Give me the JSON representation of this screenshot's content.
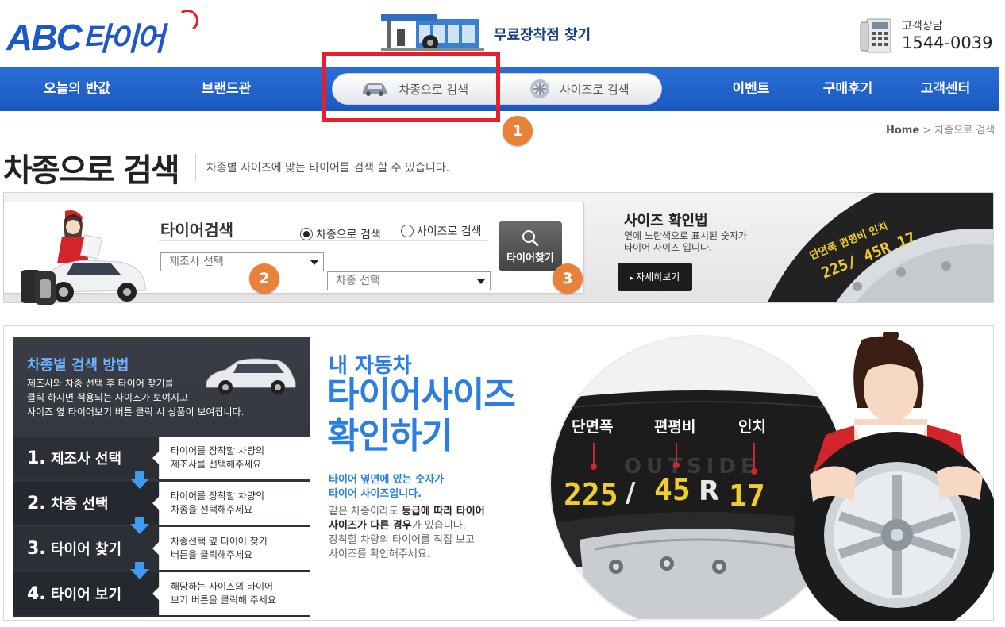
{
  "header": {
    "logo_latin": "ABC",
    "logo_korean": "타이어",
    "store_link": "무료장착점 찾기",
    "cs_label": "고객상담",
    "cs_number": "1544-0039"
  },
  "nav": {
    "items": [
      "오늘의 반값",
      "브랜드관",
      "이벤트",
      "구매후기",
      "고객센터"
    ],
    "search_tabs": [
      "차종으로 검색",
      "사이즈로 검색"
    ]
  },
  "markers": [
    "1",
    "2",
    "3"
  ],
  "breadcrumb": {
    "home": "Home",
    "separator": ">",
    "current": "차종으로 검색"
  },
  "page": {
    "title": "차종으로 검색",
    "description": "차종별 사이즈에 맞는 타이어를 검색 할 수 있습니다."
  },
  "search": {
    "title": "타이어검색",
    "radio_options": [
      "차종으로 검색",
      "사이즈로 검색"
    ],
    "selected_radio": "차종으로 검색",
    "manufacturer_select": "제조사 선택",
    "model_select": "차종 선택",
    "find_button": "타이어찾기"
  },
  "size_check": {
    "title": "사이즈 확인법",
    "desc_line1": "옆에 노란색으로 표시된 숫자가",
    "desc_line2": "타이어 사이즈 입니다.",
    "detail_button": "자세히보기",
    "sidewall_text": "단면폭 편평비 인치",
    "sidewall_size": "225/ 45R 17"
  },
  "guide": {
    "title": "차종별 검색 방법",
    "desc_line1": "제조사와 차종 선택 후 타이어 찾기를",
    "desc_line2": "클릭 하시면 적용되는 사이즈가 보여지고",
    "desc_line3": "사이즈 옆 타이어보기 버튼 클릭 시 상품이 보여집니다.",
    "steps": [
      {
        "num": "1.",
        "name": "제조사 선택",
        "desc1": "타이어를 장착할 차량의",
        "desc2": "제조사를 선택해주세요"
      },
      {
        "num": "2.",
        "name": "차종 선택",
        "desc1": "타이어를 장착할 차량의",
        "desc2": "차종을 선택해주세요"
      },
      {
        "num": "3.",
        "name": "타이어 찾기",
        "desc1": "차종선택 옆 타이어 찾기",
        "desc2": "버튼을 클릭해주세요"
      },
      {
        "num": "4.",
        "name": "타이어 보기",
        "desc1": "해당하는 사이즈의 타이어",
        "desc2": "보기 버튼을 클릭해 주세요"
      }
    ]
  },
  "tire_check": {
    "kicker": "내 자동차",
    "head_line1": "타이어사이즈",
    "head_line2": "확인하기",
    "highlight_line1": "타이어 옆면에 있는 숫자가",
    "highlight_line2": "타이어 사이즈입니다.",
    "body_line1_pre": "같은 차종이라도 ",
    "body_line1_bold": "등급에 따라 타이어",
    "body_line2_bold": "사이즈가 다른 경우",
    "body_line2_post": "가 있습니다.",
    "body_line3": "장착할 차량의 타이어를 직접 보고",
    "body_line4": "사이즈를 확인해주세요.",
    "labels": [
      "단면폭",
      "편평비",
      "인치"
    ],
    "size_parts": [
      "225",
      "/",
      "45",
      "R",
      "17"
    ],
    "sidewall_brand": "OUTSIDE"
  },
  "colors": {
    "brand_blue": "#1e58c4",
    "nav_blue": "#2265cf",
    "highlight_red": "#e81e2a",
    "marker_orange": "#e9813b",
    "guide_dark": "#33363e",
    "tire_yellow": "#f0cc2e"
  }
}
